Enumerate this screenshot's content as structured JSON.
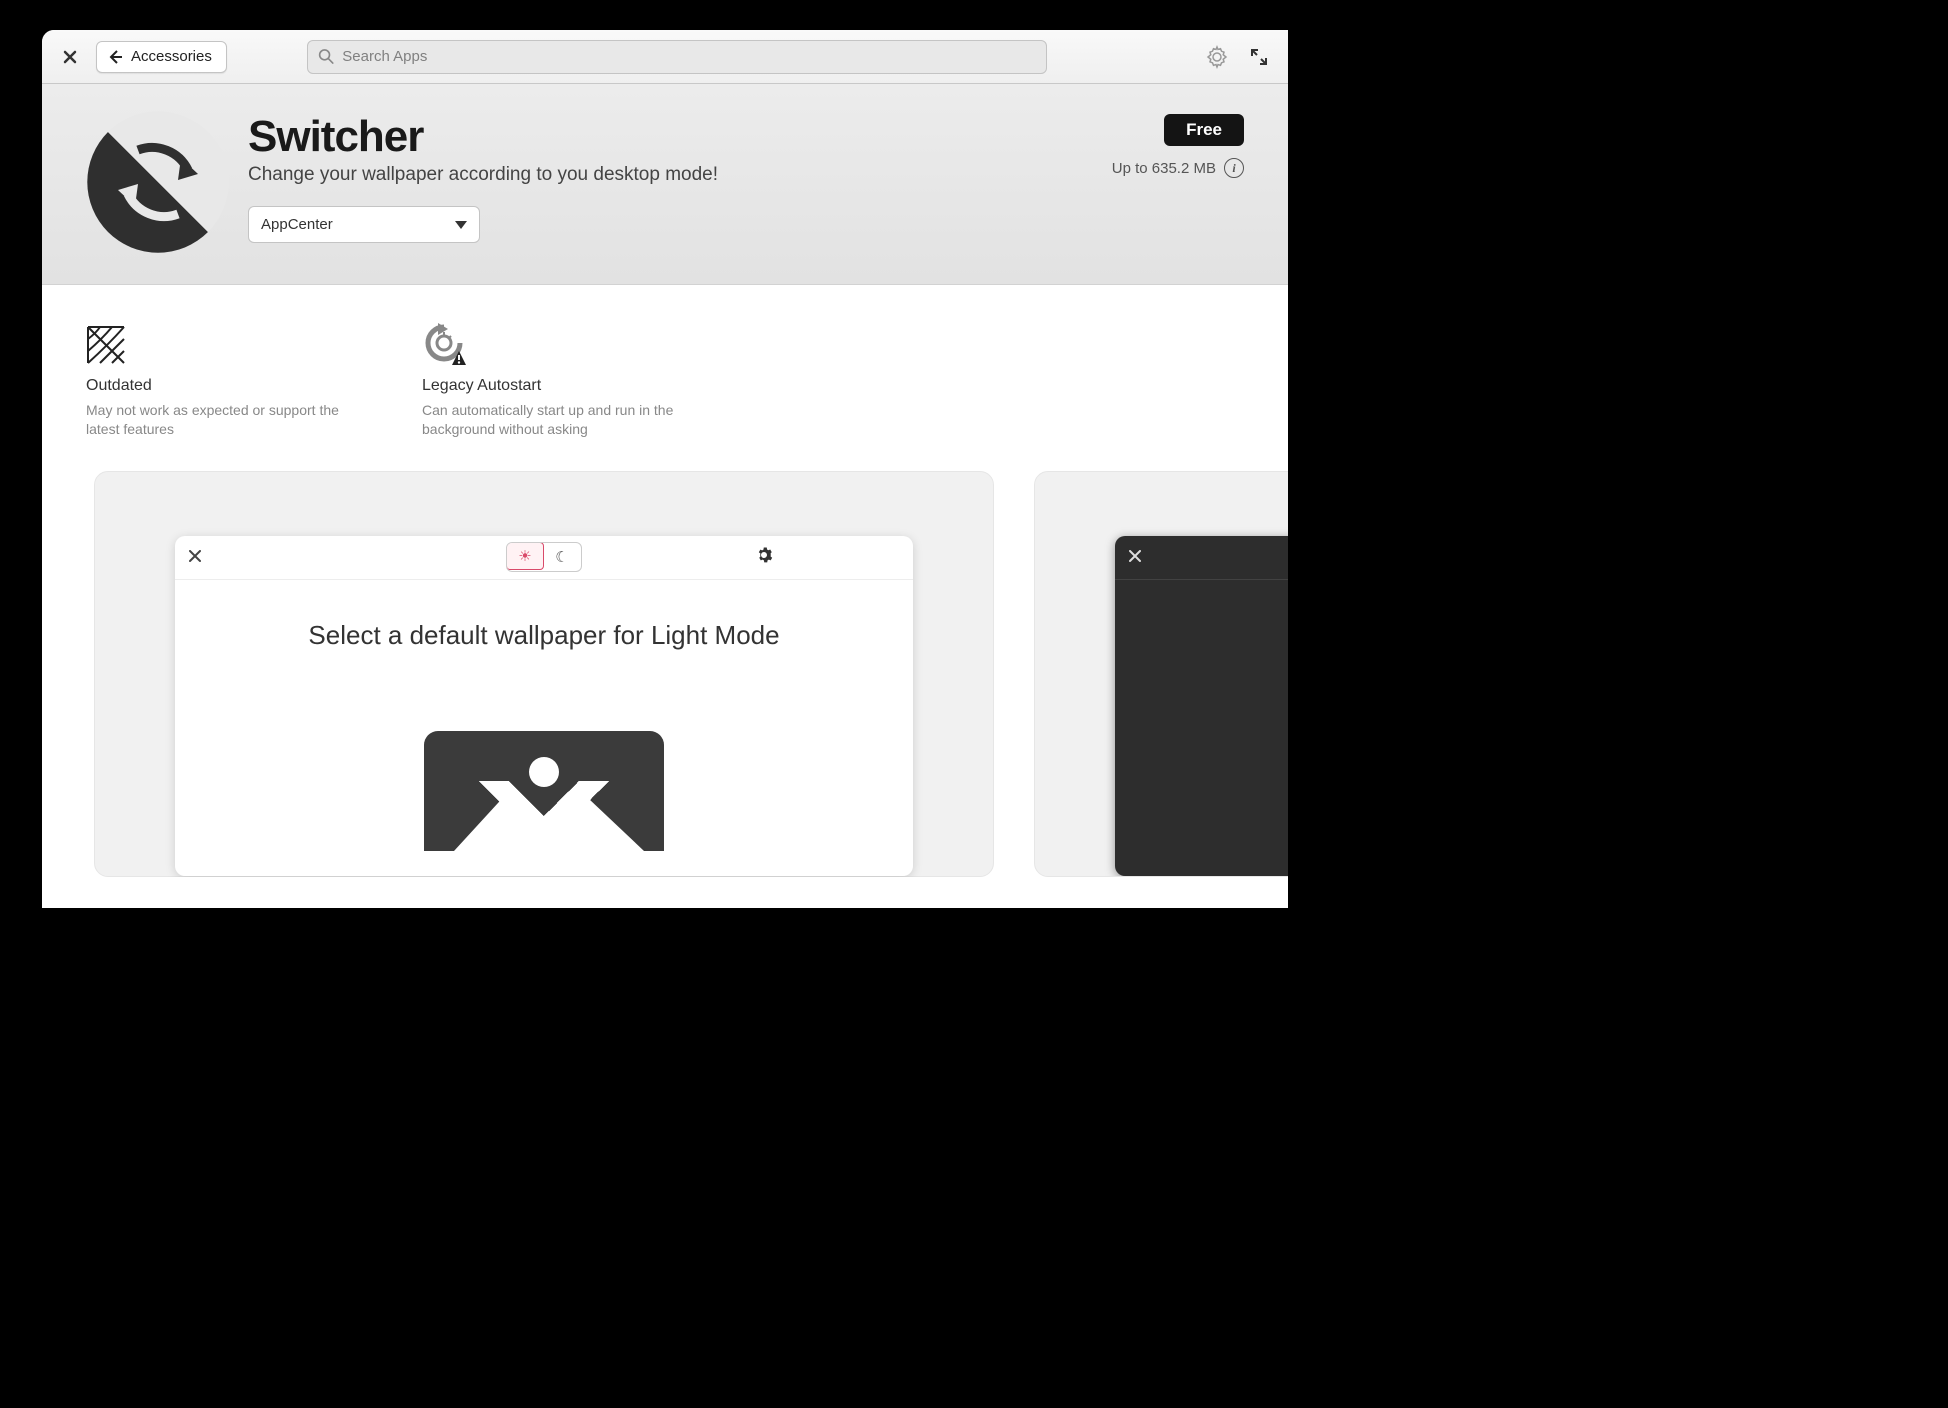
{
  "toolbar": {
    "back_label": "Accessories",
    "search_placeholder": "Search Apps"
  },
  "app": {
    "title": "Switcher",
    "tagline": "Change your wallpaper according to you desktop mode!",
    "source": "AppCenter",
    "price": "Free",
    "size": "Up to 635.2 MB"
  },
  "warnings": [
    {
      "title": "Outdated",
      "desc": "May not work as expected or support the latest features"
    },
    {
      "title": "Legacy Autostart",
      "desc": "Can automatically start up and run in the background without asking"
    }
  ],
  "screenshot": {
    "message": "Select a default wallpaper for Light Mode"
  }
}
